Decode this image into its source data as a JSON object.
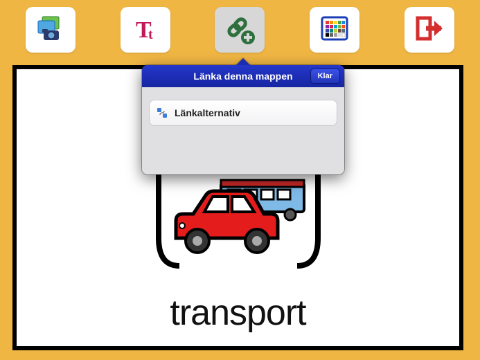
{
  "toolbar": {
    "items": [
      {
        "name": "photos-icon"
      },
      {
        "name": "text-icon"
      },
      {
        "name": "link-add-icon",
        "active": true
      },
      {
        "name": "color-palette-icon"
      },
      {
        "name": "exit-icon"
      }
    ]
  },
  "card": {
    "label": "transport"
  },
  "popover": {
    "title": "Länka denna mappen",
    "done": "Klar",
    "option_label": "Länkalternativ"
  }
}
